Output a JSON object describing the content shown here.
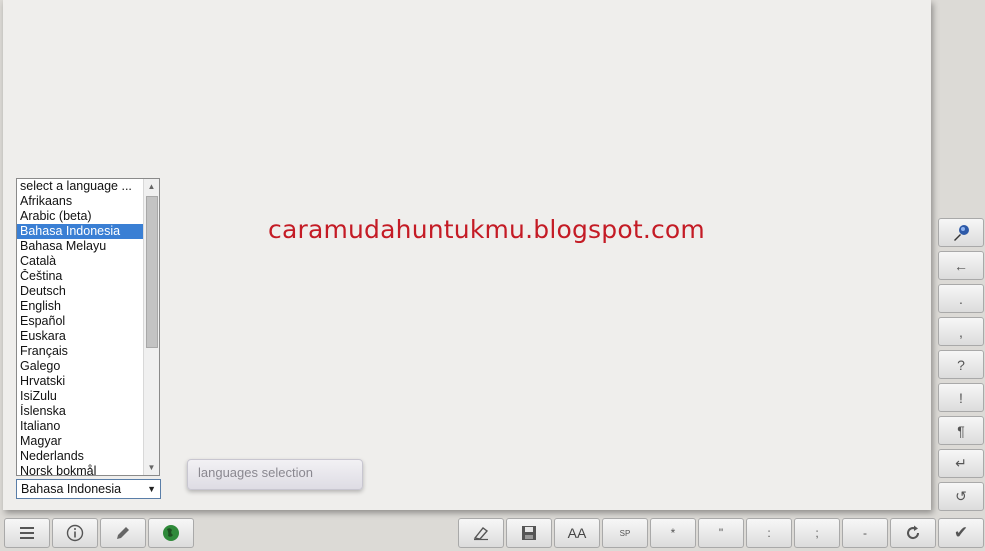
{
  "watermark": "caramudahuntukmu.blogspot.com",
  "language_list": {
    "items": [
      "select a language ...",
      "Afrikaans",
      "Arabic (beta)",
      "Bahasa Indonesia",
      "Bahasa Melayu",
      "Català",
      "Čeština",
      "Deutsch",
      "English",
      "Español",
      "Euskara",
      "Français",
      "Galego",
      "Hrvatski",
      "IsiZulu",
      "Íslenska",
      "Italiano",
      "Magyar",
      "Nederlands",
      "Norsk bokmål"
    ],
    "selected": "Bahasa Indonesia"
  },
  "select_value": "Bahasa Indonesia",
  "tooltip": "languages selection",
  "right_toolbar": {
    "microphone_icon": "microphone-icon",
    "backspace": "←",
    "period": ".",
    "comma": ",",
    "question": "?",
    "exclamation": "!",
    "paragraph": "¶",
    "newline": "↵",
    "undo": "↺"
  },
  "bottom_toolbar": {
    "font_size": "AA",
    "space": "SP",
    "asterisk": "*",
    "quote": "\"",
    "colon": ":",
    "semicolon": ";",
    "dash": "-",
    "checkmark": "✔"
  },
  "colors": {
    "watermark": "#c41b25",
    "selection": "#3a7fd4",
    "paper": "#efeeec"
  }
}
